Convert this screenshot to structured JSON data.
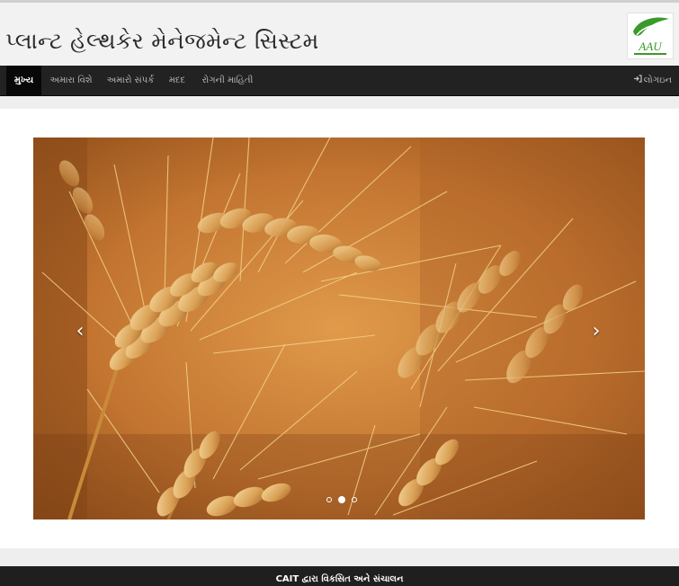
{
  "header": {
    "title": "પ્લાન્ટ હેલ્થકેર મેનેજમેન્ટ સિસ્ટમ",
    "logo_text": "AAU",
    "logo_icon": "leaf-icon"
  },
  "nav": {
    "items": [
      {
        "label": "મુખ્ય",
        "active": true
      },
      {
        "label": "અમારા વિશે",
        "active": false
      },
      {
        "label": "અમારો સંપર્ક",
        "active": false
      },
      {
        "label": "મદદ",
        "active": false
      },
      {
        "label": "રોગની માહિતી",
        "active": false
      }
    ],
    "login_label": "લોગઇન",
    "login_icon": "sign-in-icon"
  },
  "carousel": {
    "prev_icon": "chevron-left-icon",
    "next_icon": "chevron-right-icon",
    "slide_count": 3,
    "active_slide": 2
  },
  "footer": {
    "text": "CAIT દ્વારા વિકસિત અને સંચાલન"
  },
  "colors": {
    "navbar": "#222222",
    "header_bg": "#f2f2f2",
    "logo_green": "#3a9a2a",
    "footer": "#1f1f1f"
  }
}
